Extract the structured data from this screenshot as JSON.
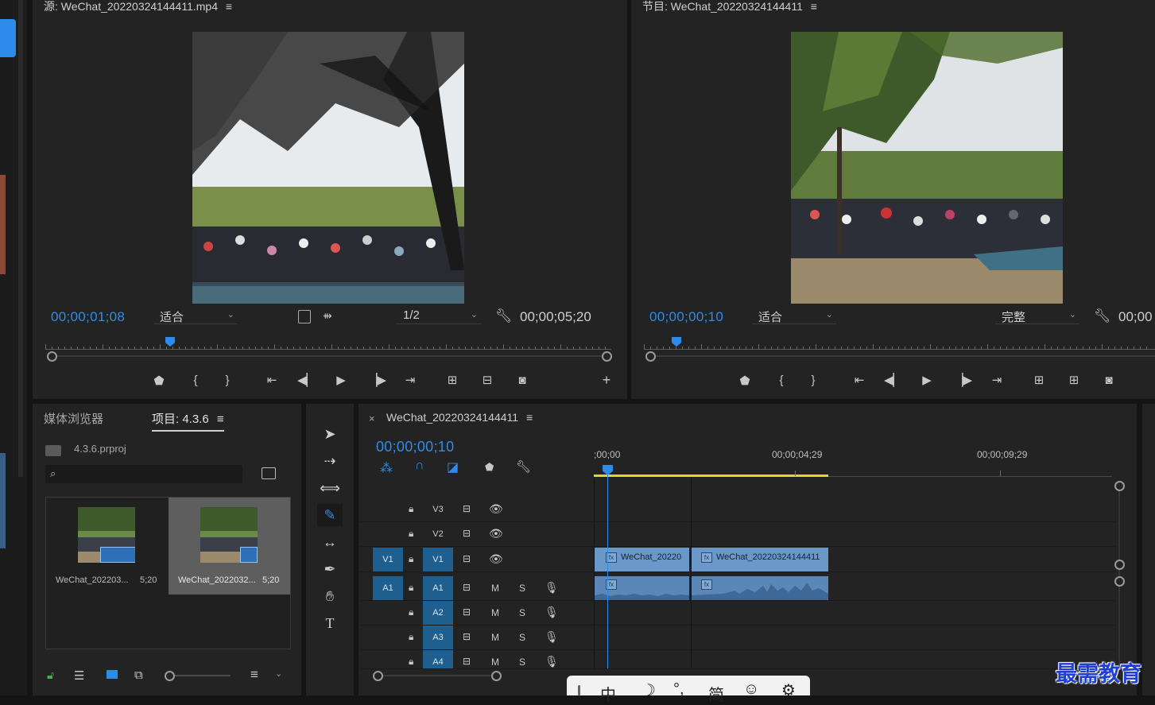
{
  "source_monitor": {
    "title": "源: WeChat_20220324144411.mp4",
    "menu_icon": "≡",
    "timecode": "00;00;01;08",
    "fit_label": "适合",
    "resolution_label": "1/2",
    "duration": "00;00;05;20"
  },
  "program_monitor": {
    "title": "节目: WeChat_20220324144411",
    "menu_icon": "≡",
    "timecode": "00;00;00;10",
    "fit_label": "适合",
    "resolution_label": "完整",
    "duration": "00;00"
  },
  "project_panel": {
    "tab_media_browser": "媒体浏览器",
    "tab_project": "项目: 4.3.6",
    "menu_icon": "≡",
    "project_file": "4.3.6.prproj",
    "search_placeholder": "",
    "items": [
      {
        "name": "WeChat_202203...",
        "duration": "5;20"
      },
      {
        "name": "WeChat_2022032...",
        "duration": "5;20"
      }
    ]
  },
  "timeline": {
    "close_icon": "×",
    "title": "WeChat_20220324144411",
    "menu_icon": "≡",
    "timecode": "00;00;00;10",
    "ruler_labels": [
      ";00;00",
      "00;00;04;29",
      "00;00;09;29"
    ],
    "video_tracks": [
      {
        "label": "V3",
        "source": ""
      },
      {
        "label": "V2",
        "source": ""
      },
      {
        "label": "V1",
        "source": "V1"
      }
    ],
    "audio_tracks": [
      {
        "label": "A1",
        "source": "A1",
        "m": "M",
        "s": "S"
      },
      {
        "label": "A2",
        "source": "",
        "m": "M",
        "s": "S"
      },
      {
        "label": "A3",
        "source": "",
        "m": "M",
        "s": "S"
      },
      {
        "label": "A4",
        "source": "",
        "m": "M",
        "s": "S"
      }
    ],
    "clips": {
      "v1_a": "WeChat_20220",
      "v1_b": "WeChat_20220324144411",
      "fx_label": "fx"
    }
  },
  "ime_bar": {
    "items": [
      "中",
      "简"
    ]
  },
  "watermark": "最需教育",
  "colors": {
    "accent_blue": "#2d8ceb",
    "panel_bg": "#232323",
    "clip_video": "#6a98c9",
    "clip_audio": "#5a86b8",
    "work_area": "#e3d52b"
  }
}
